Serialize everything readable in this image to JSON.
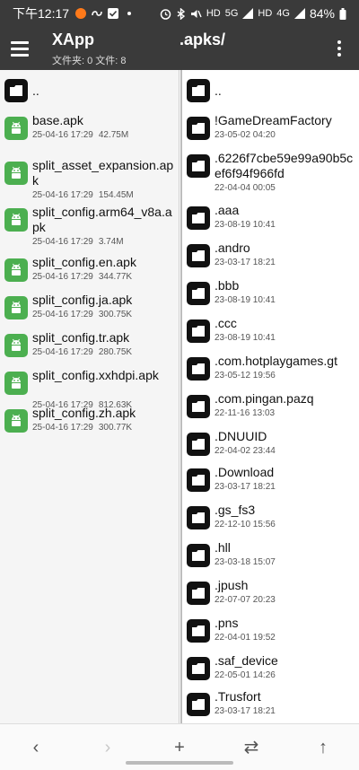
{
  "status": {
    "time": "下午12:17",
    "hd1": "HD",
    "net": "5G",
    "hd2": "HD",
    "signal": "4G",
    "battery": "84%"
  },
  "header": {
    "title": "XApp",
    "subtitle": "文件夹: 0  文件: 8",
    "path": ".apks/"
  },
  "left_pane": {
    "parent": "..",
    "files": [
      {
        "name": "base.apk",
        "date": "25-04-16 17:29",
        "size": "42.75M"
      },
      {
        "name": "split_asset_expansion.apk",
        "date": "25-04-16 17:29",
        "size": "154.45M"
      },
      {
        "name": "split_config.arm64_v8a.apk",
        "date": "25-04-16 17:29",
        "size": "3.74M"
      },
      {
        "name": "split_config.en.apk",
        "date": "25-04-16 17:29",
        "size": "344.77K"
      },
      {
        "name": "split_config.ja.apk",
        "date": "25-04-16 17:29",
        "size": "300.75K"
      },
      {
        "name": "split_config.tr.apk",
        "date": "25-04-16 17:29",
        "size": "280.75K"
      },
      {
        "name": "split_config.xxhdpi.apk",
        "date": "25-04-16 17:29",
        "size": "812.63K"
      },
      {
        "name": "split_config.zh.apk",
        "date": "25-04-16 17:29",
        "size": "300.77K"
      }
    ]
  },
  "right_pane": {
    "parent": "..",
    "folders": [
      {
        "name": "!GameDreamFactory",
        "date": "23-05-02 04:20"
      },
      {
        "name": ".6226f7cbe59e99a90b5cef6f94f966fd",
        "date": "22-04-04 00:05"
      },
      {
        "name": ".aaa",
        "date": "23-08-19 10:41"
      },
      {
        "name": ".andro",
        "date": "23-03-17 18:21"
      },
      {
        "name": ".bbb",
        "date": "23-08-19 10:41"
      },
      {
        "name": ".ccc",
        "date": "23-08-19 10:41"
      },
      {
        "name": ".com.hotplaygames.gt",
        "date": "23-05-12 19:56"
      },
      {
        "name": ".com.pingan.pazq",
        "date": "22-11-16 13:03"
      },
      {
        "name": ".DNUUID",
        "date": "22-04-02 23:44"
      },
      {
        "name": ".Download",
        "date": "23-03-17 18:21"
      },
      {
        "name": ".gs_fs3",
        "date": "22-12-10 15:56"
      },
      {
        "name": ".hll",
        "date": "23-03-18 15:07"
      },
      {
        "name": ".jpush",
        "date": "22-07-07 20:23"
      },
      {
        "name": ".pns",
        "date": "22-04-01 19:52"
      },
      {
        "name": ".saf_device",
        "date": "22-05-01 14:26"
      },
      {
        "name": ".Trusfort",
        "date": "23-03-17 18:21"
      }
    ]
  },
  "bottom_nav": {
    "back": "‹",
    "forward": "›",
    "add": "+",
    "swap": "⇄",
    "up": "↑"
  }
}
